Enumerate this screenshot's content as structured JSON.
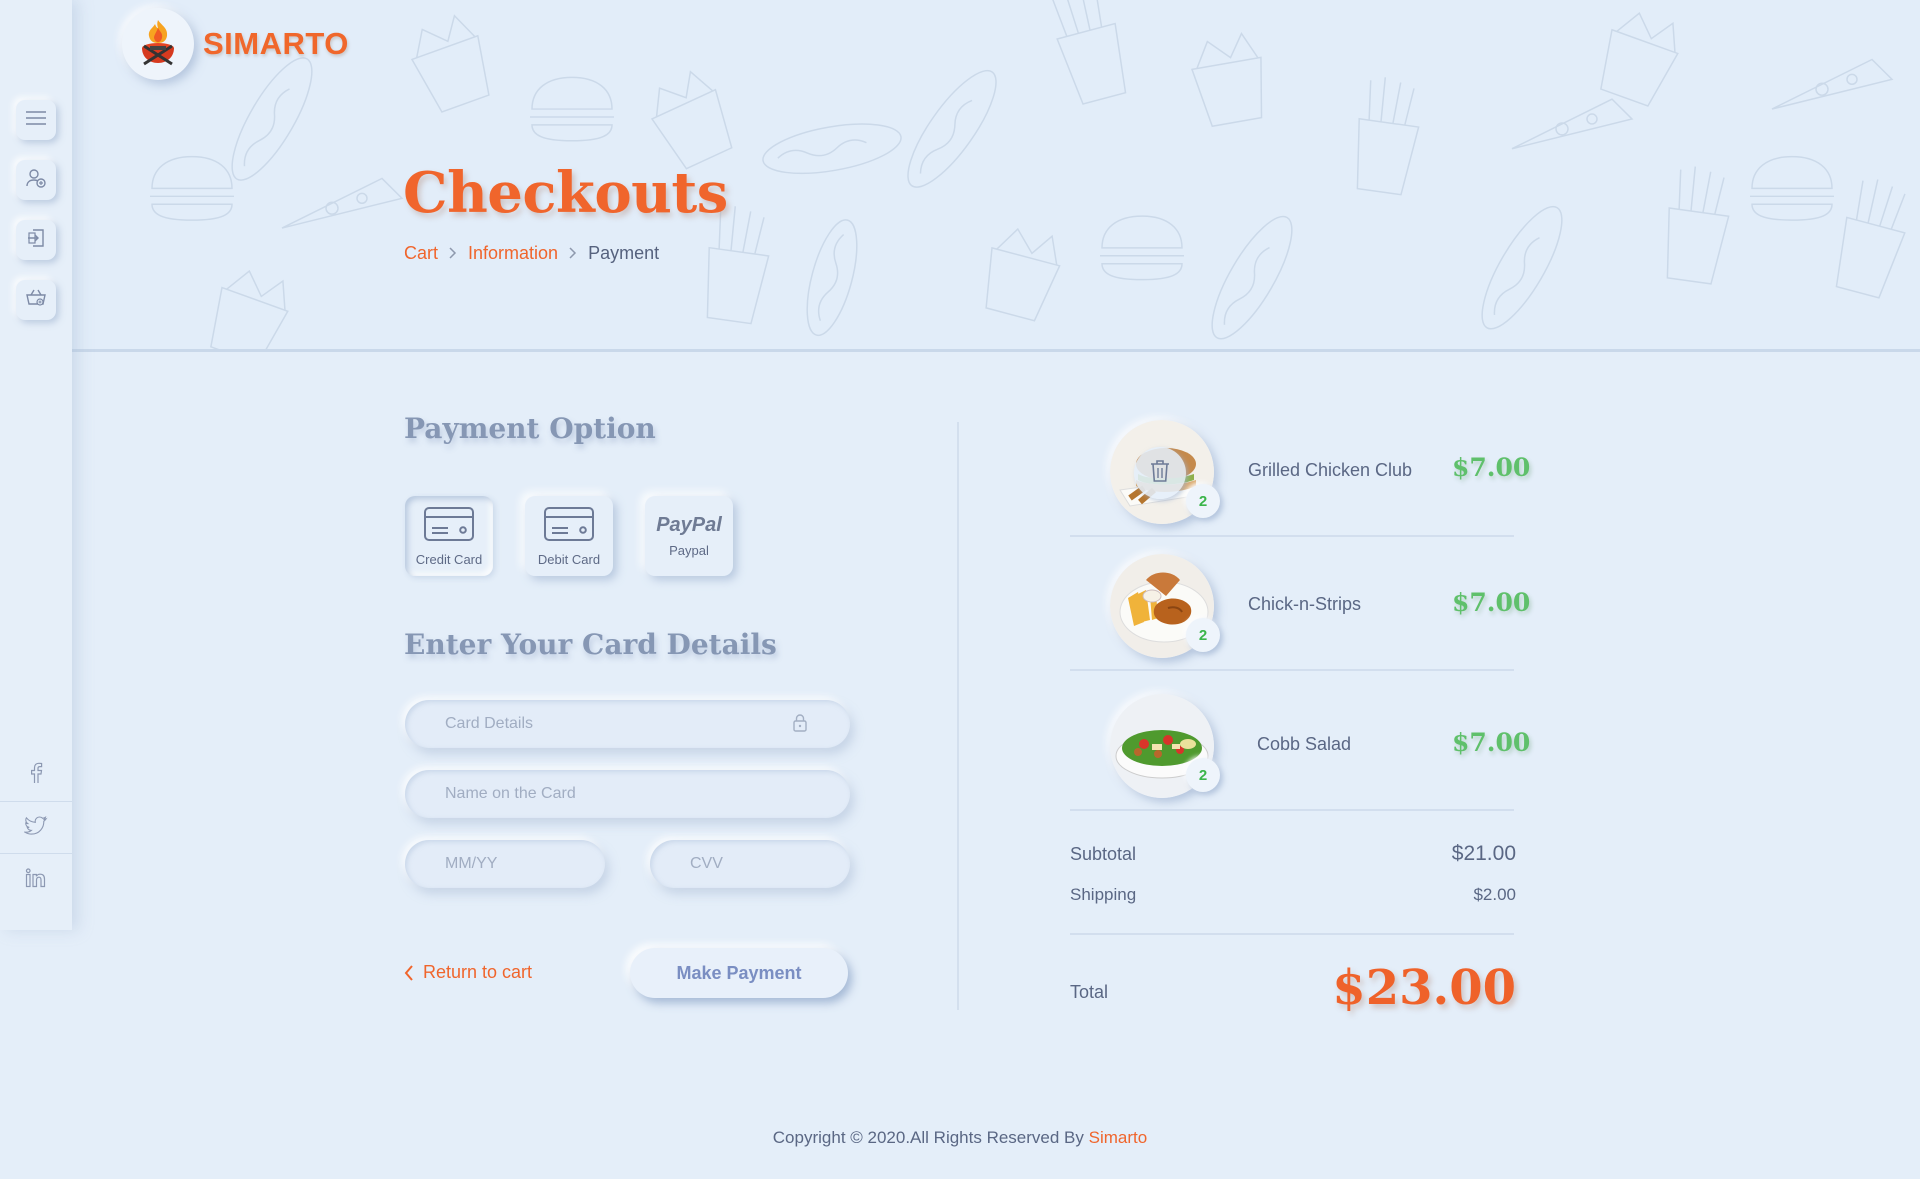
{
  "brand": {
    "name": "SIMARTO"
  },
  "sidebar": {
    "items": [
      {
        "icon": "menu-icon"
      },
      {
        "icon": "user-add-icon"
      },
      {
        "icon": "login-icon"
      },
      {
        "icon": "cart-icon"
      }
    ],
    "social": [
      {
        "icon": "facebook-icon"
      },
      {
        "icon": "twitter-icon"
      },
      {
        "icon": "linkedin-icon"
      }
    ]
  },
  "header": {
    "title": "Checkouts",
    "breadcrumb": [
      "Cart",
      "Information",
      "Payment"
    ]
  },
  "payment": {
    "section_title": "Payment Option",
    "options": [
      {
        "label": "Credit Card",
        "icon": "credit-card-icon",
        "selected": true
      },
      {
        "label": "Debit Card",
        "icon": "debit-card-icon",
        "selected": false
      },
      {
        "label": "Paypal",
        "logo_text": "PayPal",
        "icon": "paypal-logo",
        "selected": false
      }
    ],
    "card_section_title": "Enter Your Card Details",
    "fields": {
      "card_details": "Card Details",
      "name_on_card": "Name on the Card",
      "expiry": "MM/YY",
      "cvv": "CVV"
    },
    "return_label": "Return to cart",
    "submit_label": "Make Payment"
  },
  "order": {
    "items": [
      {
        "name": "Grilled Chicken Club",
        "price": "$7.00",
        "qty": "2"
      },
      {
        "name": "Chick-n-Strips",
        "price": "$7.00",
        "qty": "2"
      },
      {
        "name": "Cobb Salad",
        "price": "$7.00",
        "qty": "2"
      }
    ],
    "subtotal_label": "Subtotal",
    "subtotal": "$21.00",
    "shipping_label": "Shipping",
    "shipping": "$2.00",
    "total_label": "Total",
    "total": "$23.00"
  },
  "footer": {
    "text": "Copyright © 2020.All Rights Reserved By",
    "brand": "Simarto"
  },
  "colors": {
    "accent": "#f0652c",
    "price_green": "#5fc06b",
    "background": "#e4eef9",
    "text": "#5a6784"
  }
}
